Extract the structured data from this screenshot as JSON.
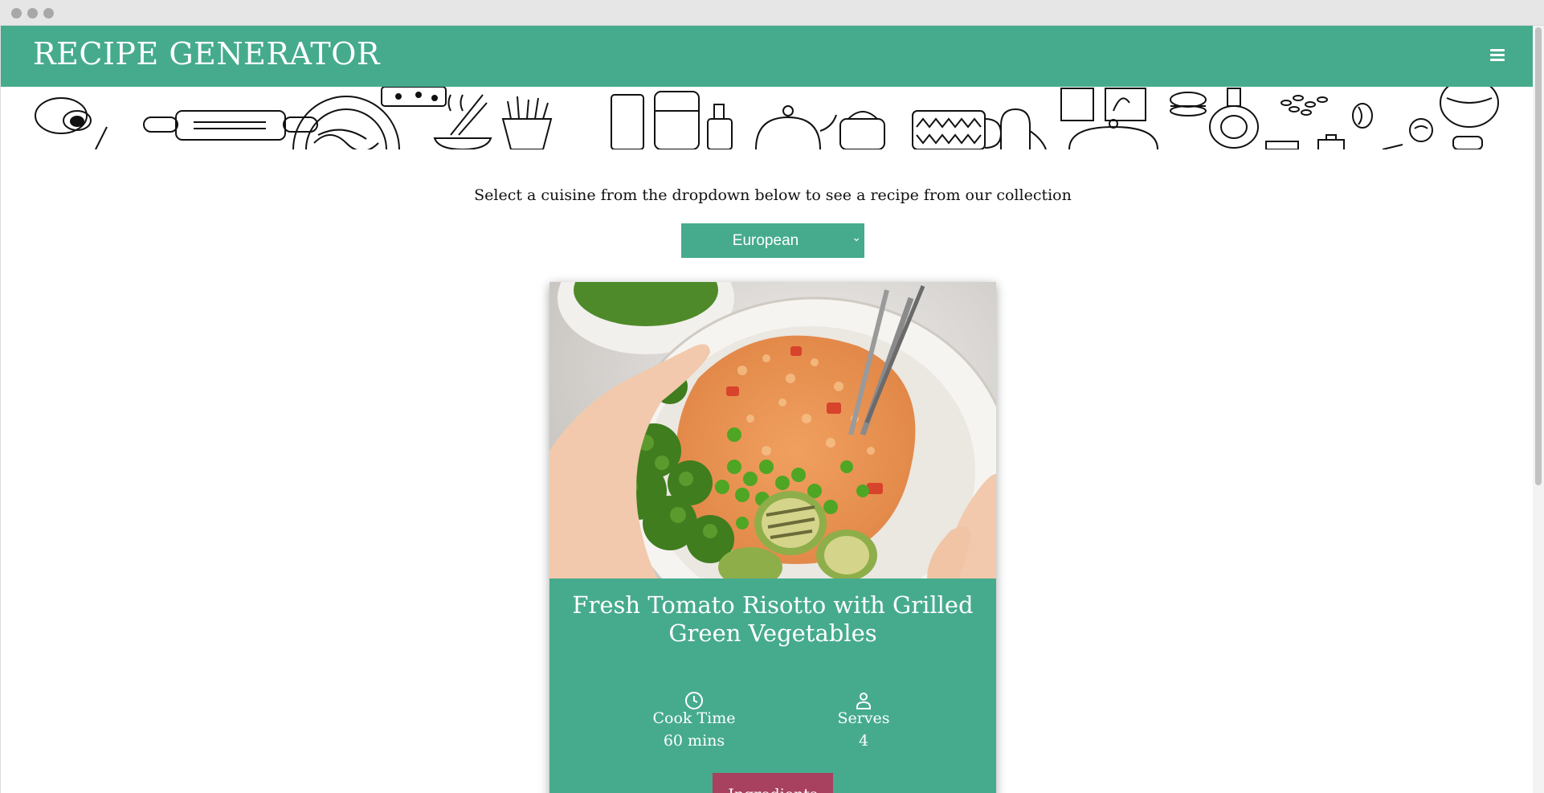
{
  "header": {
    "brand": "RECIPE GENERATOR",
    "menu_icon": "hamburger-menu-icon",
    "background_color": "#46ab8d"
  },
  "intro": {
    "text": "Select a cuisine from the dropdown below to see a recipe from our collection"
  },
  "cuisine_select": {
    "selected": "European",
    "chevron": "⌄"
  },
  "recipe": {
    "title": "Fresh Tomato Risotto with Grilled Green Vegetables",
    "image_alt": "Bowl of tomato risotto with broccoli, peas and grilled zucchini",
    "cook_time": {
      "label": "Cook Time",
      "value": "60 mins",
      "icon": "clock-icon"
    },
    "serves": {
      "label": "Serves",
      "value": "4",
      "icon": "person-icon"
    },
    "ingredients_button": "Ingredients",
    "button_color": "#a8405f"
  }
}
